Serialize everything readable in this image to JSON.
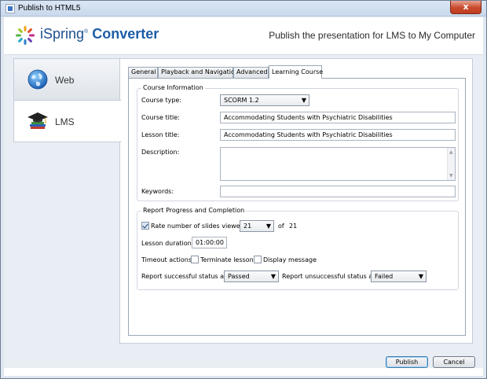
{
  "window": {
    "title": "Publish to HTML5",
    "close_label": "x"
  },
  "header": {
    "logo_prefix": "iSpring",
    "logo_sup": "®",
    "logo_suffix": "Converter",
    "subtitle": "Publish the presentation for LMS to My Computer"
  },
  "nav": {
    "items": [
      {
        "label": "Web",
        "icon": "globe-icon",
        "active": false
      },
      {
        "label": "LMS",
        "icon": "graduation-cap-icon",
        "active": true
      }
    ]
  },
  "tabs": [
    {
      "label": "General"
    },
    {
      "label": "Playback and Navigation"
    },
    {
      "label": "Advanced"
    },
    {
      "label": "Learning Course",
      "active": true
    }
  ],
  "course_info": {
    "group_title": "Course Information",
    "course_type_label": "Course type:",
    "course_type_value": "SCORM 1.2",
    "course_title_label": "Course title:",
    "course_title_value": "Accommodating Students with Psychiatric Disabilities",
    "lesson_title_label": "Lesson title:",
    "lesson_title_value": "Accommodating Students with Psychiatric Disabilities",
    "description_label": "Description:",
    "description_value": "",
    "keywords_label": "Keywords:",
    "keywords_value": ""
  },
  "report": {
    "group_title": "Report Progress and Completion",
    "rate_label": "Rate number of slides viewed:",
    "rate_checked": true,
    "rate_value": "21",
    "of_label": "of",
    "total_slides": "21",
    "lesson_duration_label": "Lesson duration:",
    "lesson_duration_value": "01:00:00",
    "timeout_label": "Timeout actions:",
    "terminate_label": "Terminate lesson",
    "terminate_checked": false,
    "display_message_label": "Display message",
    "display_message_checked": false,
    "success_label": "Report successful status as:",
    "success_value": "Passed",
    "unsuccess_label": "Report unsuccessful status as:",
    "unsuccess_value": "Failed"
  },
  "buttons": {
    "publish": "Publish",
    "cancel": "Cancel"
  },
  "colors": {
    "accent": "#1e5ca6",
    "frame": "#dfe7f1",
    "close": "#c94a2d"
  }
}
